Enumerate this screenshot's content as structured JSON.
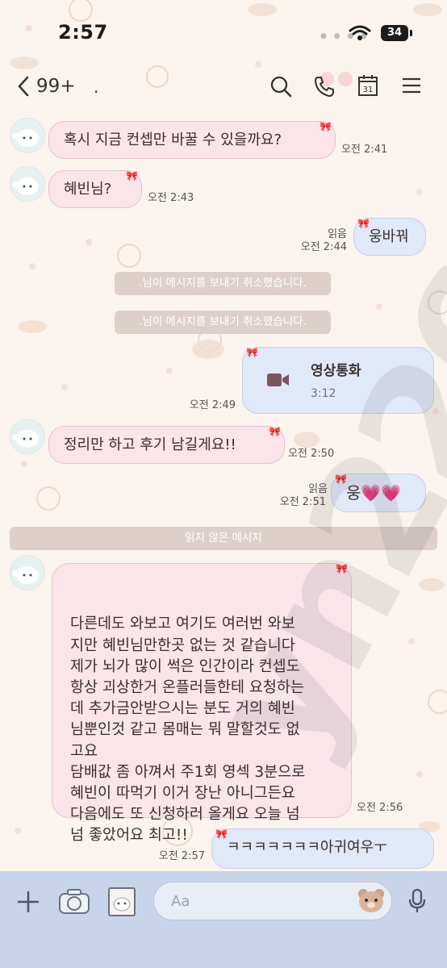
{
  "status_bar": {
    "time": "2:57",
    "battery": "34"
  },
  "header": {
    "back_count": "99+",
    "title": "."
  },
  "messages": {
    "m1": {
      "text": "혹시 지금 컨셉만 바꿀 수 있을까요?",
      "time": "오전 2:41"
    },
    "m2": {
      "text": "혜빈님?",
      "time": "오전 2:43"
    },
    "m3": {
      "text": "웅바꿔",
      "read": "읽음",
      "time": "오전 2:44"
    },
    "sys1": {
      "text": ".님이 메시지를 보내기 취소했습니다."
    },
    "sys2": {
      "text": ".님이 메시지를 보내기 취소했습니다."
    },
    "m4": {
      "call_label": "영상통화",
      "duration": "3:12",
      "time": "오전 2:49"
    },
    "m5": {
      "text": "정리만 하고 후기 남길게요!!",
      "time": "오전 2:50"
    },
    "m6": {
      "text": "웅💗💗",
      "read": "읽음",
      "time": "오전 2:51"
    },
    "divider": {
      "text": "읽지 않은 메시지"
    },
    "m7": {
      "text": "다른데도 와보고 여기도 여러번 와보\n지만 혜빈님만한곳 없는 것 같습니다\n제가 뇌가 많이 썩은 인간이라 컨셉도\n항상 괴상한거 온플러들한테 요청하는\n데 추가금안받으시는 분도 거의 혜빈\n님뿐인것 같고 몸매는 뭐 말할것도 없\n고요\n담배값 좀 아껴서 주1회 영섹 3분으로\n혜빈이 따먹기 이거 장난 아니그든요\n다음에도 또 신청하러 올게요 오늘 넘\n넘 좋았어요 최고!!",
      "time": "오전 2:56"
    },
    "m8": {
      "text": "ㅋㅋㅋㅋㅋㅋㅋ아귀여우ㅜ",
      "time": "오전 2:57"
    }
  },
  "input": {
    "placeholder": "Aa"
  },
  "watermark": "yn226",
  "icons": [
    "back-icon",
    "search-icon",
    "phone-icon",
    "calendar-icon",
    "menu-icon",
    "video-icon",
    "plus-icon",
    "camera-icon",
    "sticker-icon",
    "emoji-icon",
    "mic-icon"
  ],
  "colors": {
    "background": "#fbf4ee",
    "bubble_left": "#fbe4ea",
    "bubble_right": "#e1e8f7",
    "bottom_bar": "#c8d4e9"
  }
}
